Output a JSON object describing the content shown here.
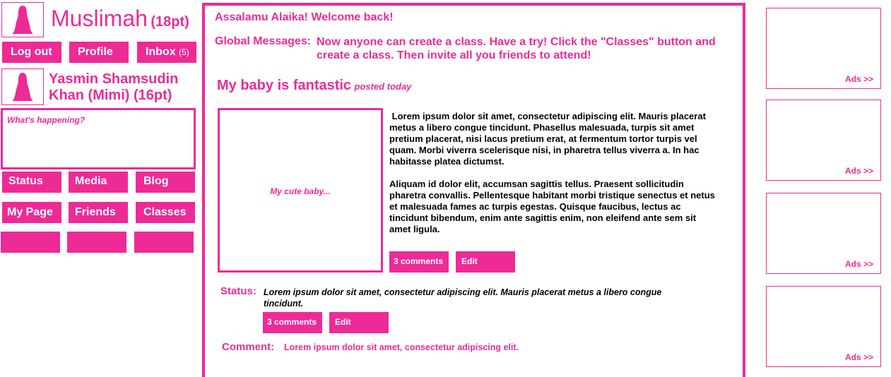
{
  "user": {
    "name": "Muslimah",
    "name_size": "(18pt)"
  },
  "nav": {
    "logout": "Log out",
    "profile": "Profile",
    "inbox": "Inbox",
    "inbox_count": "(5)"
  },
  "friend": {
    "name_line1": "Yasmin Shamsudin",
    "name_line2": "Khan (Mimi) (16pt)"
  },
  "status_box": {
    "placeholder": "What's happening?"
  },
  "menu": {
    "status": "Status",
    "media": "Media",
    "blog": "Blog",
    "my_page": "My Page",
    "friends": "Friends",
    "classes": "Classes"
  },
  "main": {
    "welcome": "Assalamu Alaika! Welcome back!",
    "global_label": "Global Messages:",
    "global_line1": "Now anyone can create a class. Have a try! Click the \"Classes\" button and",
    "global_line2": "create a class. Then invite all you friends to attend!",
    "post": {
      "title": "My baby is fantastic",
      "posted": "posted today",
      "image_caption": "My cute baby...",
      "paragraph1": " Lorem ipsum dolor sit amet, consectetur adipiscing elit. Mauris placerat metus a libero congue tincidunt. Phasellus malesuada, turpis sit amet pretium placerat, nisi lacus pretium erat, at fermentum tortor turpis vel quam. Morbi viverra scelerisque nisi, in pharetra tellus viverra a. In hac habitasse platea dictumst.",
      "paragraph2": "Aliquam id dolor elit, accumsan sagittis tellus. Praesent sollicitudin pharetra convallis. Pellentesque habitant morbi tristique senectus et netus et malesuada fames ac turpis egestas. Quisque faucibus, lectus ac tincidunt bibendum, enim ante sagittis enim, non eleifend ante sem sit amet ligula.",
      "comments": "3 comments",
      "edit": "Edit"
    },
    "status": {
      "label": "Status:",
      "text": "Lorem ipsum dolor sit amet, consectetur adipiscing elit. Mauris placerat metus a libero congue tincidunt.",
      "comments": "3 comments",
      "edit": "Edit"
    },
    "comment": {
      "label": "Comment:",
      "text": "Lorem ipsum dolor sit amet, consectetur adipiscing elit."
    }
  },
  "ads": [
    "Ads >>",
    "Ads >>",
    "Ads >>",
    "Ads >>"
  ],
  "colors": {
    "accent": "#ee2a96"
  },
  "icons": [
    "avatar-ghost-icon"
  ]
}
